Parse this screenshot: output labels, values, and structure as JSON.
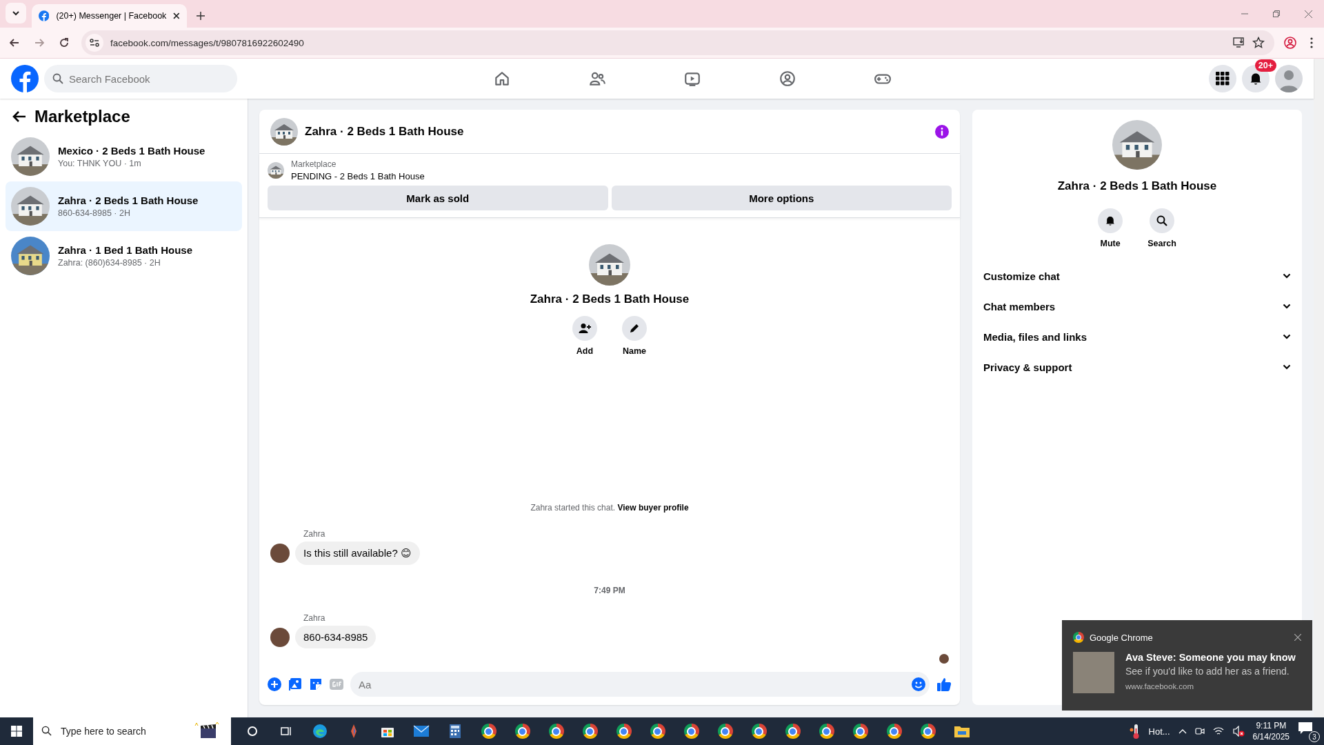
{
  "browser": {
    "tab_title": "(20+) Messenger | Facebook",
    "url": "facebook.com/messages/t/9807816922602490"
  },
  "header": {
    "search_placeholder": "Search Facebook",
    "nav": [
      {
        "kind": "home"
      },
      {
        "kind": "friends"
      },
      {
        "kind": "video"
      },
      {
        "kind": "groups"
      },
      {
        "kind": "gaming"
      }
    ],
    "notification_badge": "20+"
  },
  "sidebar": {
    "title": "Marketplace",
    "conversations": [
      {
        "title": "Mexico · 2 Beds 1 Bath House",
        "subtitle": "You: THNK YOU · 1m",
        "selected": false,
        "kind": "white-house"
      },
      {
        "title": "Zahra · 2 Beds 1 Bath House",
        "subtitle": "860-634-8985 · 2H",
        "selected": true,
        "kind": "white-house"
      },
      {
        "title": "Zahra · 1 Bed 1 Bath House",
        "subtitle": "Zahra: (860)634-8985 · 2H",
        "selected": false,
        "kind": "yellow-house"
      }
    ]
  },
  "chat": {
    "title": "Zahra · 2 Beds 1 Bath House",
    "listing": {
      "label": "Marketplace",
      "status": "PENDING - 2 Beds 1 Bath House"
    },
    "actions": [
      "Mark as sold",
      "More options"
    ],
    "intro": {
      "title": "Zahra · 2 Beds 1 Bath House",
      "buttons": [
        {
          "kind": "add",
          "label": "Add"
        },
        {
          "kind": "name",
          "label": "Name"
        }
      ]
    },
    "started": {
      "text": "Zahra started this chat.",
      "link": "View buyer profile"
    },
    "messages": [
      {
        "kind": "message",
        "sender": "Zahra",
        "text": "Is this still available? 😊"
      },
      {
        "kind": "time",
        "text": "7:49 PM"
      },
      {
        "kind": "message",
        "sender": "Zahra",
        "text": "860-634-8985"
      }
    ],
    "composer": {
      "placeholder": "Aa"
    }
  },
  "details": {
    "title": "Zahra · 2 Beds 1 Bath House",
    "actions": [
      {
        "kind": "mute",
        "label": "Mute"
      },
      {
        "kind": "search",
        "label": "Search"
      }
    ],
    "sections": [
      {
        "label": "Customize chat",
        "expanded": false
      },
      {
        "label": "Chat members",
        "expanded": false
      },
      {
        "label": "Media, files and links",
        "expanded": false
      },
      {
        "label": "Privacy & support",
        "expanded": false
      }
    ]
  },
  "notification": {
    "app": "Google Chrome",
    "title": "Ava Steve: Someone you may know",
    "body": "See if you'd like to add her as a friend.",
    "source": "www.facebook.com"
  },
  "taskbar": {
    "search_placeholder": "Type here to search",
    "apps": [
      {
        "kind": "cortana"
      },
      {
        "kind": "taskview"
      },
      {
        "kind": "edge"
      },
      {
        "kind": "app"
      },
      {
        "kind": "store"
      },
      {
        "kind": "mail"
      },
      {
        "kind": "calculator"
      },
      {
        "kind": "chrome"
      },
      {
        "kind": "chrome"
      },
      {
        "kind": "chrome"
      },
      {
        "kind": "chrome"
      },
      {
        "kind": "chrome"
      },
      {
        "kind": "chrome"
      },
      {
        "kind": "chrome"
      },
      {
        "kind": "chrome"
      },
      {
        "kind": "chrome"
      },
      {
        "kind": "chrome"
      },
      {
        "kind": "chrome"
      },
      {
        "kind": "chrome"
      },
      {
        "kind": "chrome"
      },
      {
        "kind": "chrome"
      },
      {
        "kind": "explorer"
      }
    ],
    "weather": "Hot...",
    "time": "9:11 PM",
    "date": "6/14/2025",
    "notification_count": "3"
  }
}
